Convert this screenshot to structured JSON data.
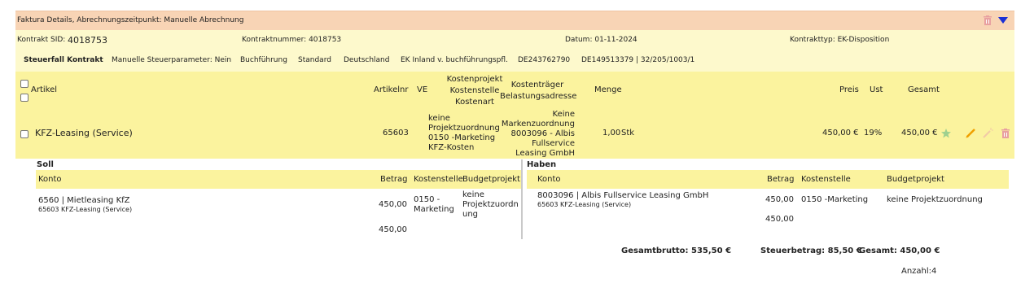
{
  "titlebar": {
    "title": "Faktura Details, Abrechnungszeitpunkt: Manuelle Abrechnung"
  },
  "contract": {
    "sid_label": "Kontrakt SID:",
    "sid_value": "4018753",
    "number": "Kontraktnummer: 4018753",
    "date": "Datum: 01-11-2024",
    "type": "Kontrakttyp: EK-Disposition"
  },
  "tax": {
    "label": "Steuerfall Kontrakt",
    "manual": "Manuelle Steuerparameter: Nein",
    "bookkeeping": "Buchführung",
    "standard": "Standard",
    "country": "Deutschland",
    "inland": "EK Inland v. buchführungspfl.",
    "vat1": "DE243762790",
    "vat2": "DE149513379 | 32/205/1003/1"
  },
  "table": {
    "headers": {
      "artikel": "Artikel",
      "artikelnr": "Artikelnr",
      "ve": "VE",
      "kost1": "Kostenprojekt",
      "kost2": "Kostenstelle",
      "kost3": "Kostenart",
      "ktr1": "Kostenträger",
      "ktr2": "Belastungsadresse",
      "menge": "Menge",
      "preis": "Preis",
      "ust": "Ust",
      "gesamt": "Gesamt"
    },
    "row": {
      "artikel": "KFZ-Leasing (Service)",
      "artikelnr": "65603",
      "kost_l1": "keine",
      "kost_l2": "Projektzuordnung",
      "kost_l3": "0150 -Marketing",
      "kost_l4": "KFZ-Kosten",
      "ktr_l1": "Keine",
      "ktr_l2": "Markenzuordnung",
      "ktr_l3": "8003096 - Albis",
      "ktr_l4": "Fullservice",
      "ktr_l5": "Leasing GmbH",
      "menge": "1,00",
      "einheit": "Stk",
      "preis": "450,00 €",
      "ust": "19%",
      "gesamt": "450,00 €"
    }
  },
  "soll": {
    "title": "Soll",
    "headers": {
      "konto": "Konto",
      "betrag": "Betrag",
      "kostenstelle": "Kostenstelle",
      "budgetprojekt": "Budgetprojekt"
    },
    "row": {
      "konto": "6560 | Mietleasing KfZ",
      "konto_sub": "65603 KFZ-Leasing (Service)",
      "betrag": "450,00",
      "ks_l1": "0150 -",
      "ks_l2": "Marketing",
      "bp_l1": "keine",
      "bp_l2": "Projektzuordn",
      "bp_l3": "ung"
    },
    "sum": "450,00"
  },
  "haben": {
    "title": "Haben",
    "headers": {
      "konto": "Konto",
      "betrag": "Betrag",
      "kostenstelle": "Kostenstelle",
      "budgetprojekt": "Budgetprojekt"
    },
    "row": {
      "konto": "8003096 | Albis Fullservice Leasing GmbH",
      "konto_sub": "65603 KFZ-Leasing (Service)",
      "betrag": "450,00",
      "kostenstelle": "0150 -Marketing",
      "budgetprojekt": "keine Projektzuordnung"
    },
    "sum": "450,00"
  },
  "totals": {
    "brutto": "Gesamtbrutto: 535,50 €",
    "steuer": "Steuerbetrag: 85,50 €",
    "gesamt": "Gesamt: 450,00 €",
    "anzahl": "Anzahl:4"
  },
  "colors": {
    "title_bg": "#f8d4b5",
    "info_bg": "#fdf9cc",
    "header_bg": "#fbf39e",
    "delete": "#e8a0a0",
    "edit": "#f0a000",
    "star": "#9fd08f",
    "arrow": "#1a2fd6"
  },
  "icons": [
    "trash-icon",
    "caret-down-icon",
    "star-icon",
    "pencil-icon",
    "wand-icon",
    "trash-icon"
  ]
}
